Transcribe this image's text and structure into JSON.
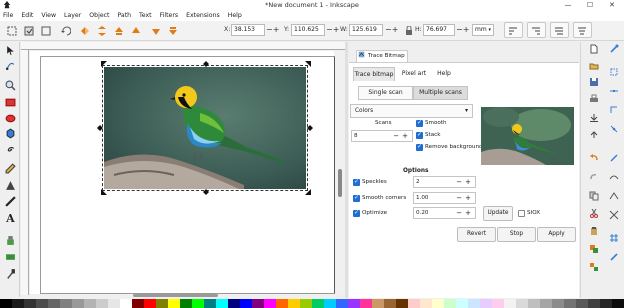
{
  "window": {
    "title": "*New document 1 - Inkscape",
    "minimize_glyph": "—",
    "maximize_glyph": "☐",
    "close_glyph": "✕"
  },
  "menu": [
    "File",
    "Edit",
    "View",
    "Layer",
    "Object",
    "Path",
    "Text",
    "Filters",
    "Extensions",
    "Help"
  ],
  "toolbar": {
    "x_label": "X:",
    "x_value": "38.153",
    "y_label": "Y:",
    "y_value": "110.625",
    "w_label": "W:",
    "w_value": "125.619",
    "h_label": "H:",
    "h_value": "76.697",
    "unit": "mm"
  },
  "dialog": {
    "tab_title": "Trace Bitmap",
    "tab_close": "⊠",
    "subtabs": [
      "Trace bitmap",
      "Pixel art",
      "Help"
    ],
    "mode_buttons": [
      "Single scan",
      "Multiple scans"
    ],
    "method": "Colors",
    "scans_label": "Scans",
    "scans_value": "8",
    "smooth_label": "Smooth",
    "stack_label": "Stack",
    "remove_bg_label": "Remove background",
    "options_title": "Options",
    "speckles_label": "Speckles",
    "speckles_value": "2",
    "smooth_corners_label": "Smooth corners",
    "smooth_corners_value": "1.00",
    "optimize_label": "Optimize",
    "optimize_value": "0.20",
    "update_label": "Update",
    "siox_label": "SIOX",
    "revert_label": "Revert",
    "stop_label": "Stop",
    "apply_label": "Apply",
    "spin_ops": "−+"
  },
  "colors": {
    "accent": "#1e6fd0",
    "icon_orange": "#e07b1a",
    "icon_green": "#3a8f3a"
  },
  "palette": [
    "#000000",
    "#1a1a1a",
    "#333333",
    "#4d4d4d",
    "#666666",
    "#808080",
    "#999999",
    "#b3b3b3",
    "#cccccc",
    "#e6e6e6",
    "#ffffff",
    "#800000",
    "#ff0000",
    "#808000",
    "#ffff00",
    "#008000",
    "#00ff00",
    "#008080",
    "#00ffff",
    "#000080",
    "#0000ff",
    "#800080",
    "#ff00ff",
    "#ff6600",
    "#ffcc00",
    "#99cc00",
    "#00cc66",
    "#00ccff",
    "#3366ff",
    "#9933ff",
    "#ff3399",
    "#cc9966",
    "#996633",
    "#663300",
    "#ffcccc",
    "#ffe6cc",
    "#ffffcc",
    "#ccffcc",
    "#ccffff",
    "#cce6ff",
    "#e6ccff",
    "#ffccee",
    "#f2f2f2",
    "#d9d9d9",
    "#bfbfbf",
    "#a6a6a6",
    "#8c8c8c",
    "#737373",
    "#595959",
    "#404040",
    "#262626",
    "#0d0d0d"
  ]
}
